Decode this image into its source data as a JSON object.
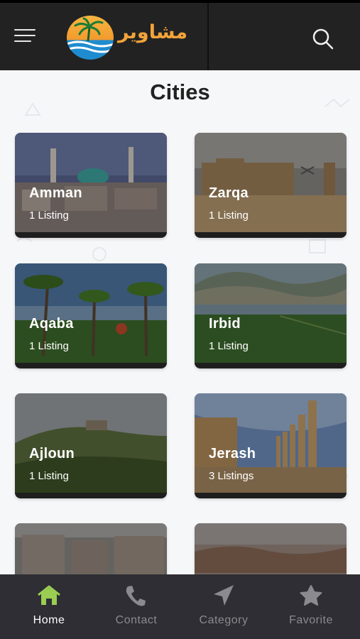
{
  "header": {
    "logo_text": "مشاوير",
    "menu_icon": "hamburger-icon",
    "search_icon": "search-icon"
  },
  "page": {
    "title": "Cities"
  },
  "cities": [
    {
      "name": "Amman",
      "count": "1 Listing"
    },
    {
      "name": "Zarqa",
      "count": "1 Listing"
    },
    {
      "name": "Aqaba",
      "count": "1 Listing"
    },
    {
      "name": "Irbid",
      "count": "1 Listing"
    },
    {
      "name": "Ajloun",
      "count": "1 Listing"
    },
    {
      "name": "Jerash",
      "count": "3 Listings"
    },
    {
      "name": "",
      "count": ""
    },
    {
      "name": "",
      "count": ""
    }
  ],
  "bottom_nav": [
    {
      "label": "Home",
      "icon": "home-icon",
      "active": true
    },
    {
      "label": "Contact",
      "icon": "phone-icon",
      "active": false
    },
    {
      "label": "Category",
      "icon": "navigation-arrow-icon",
      "active": false
    },
    {
      "label": "Favorite",
      "icon": "star-icon",
      "active": false
    }
  ],
  "colors": {
    "header_bg": "#222222",
    "nav_bg": "#2e2e34",
    "active_icon": "#9acd52",
    "inactive": "#8a8a8f",
    "logo_orange": "#f2a33a"
  }
}
